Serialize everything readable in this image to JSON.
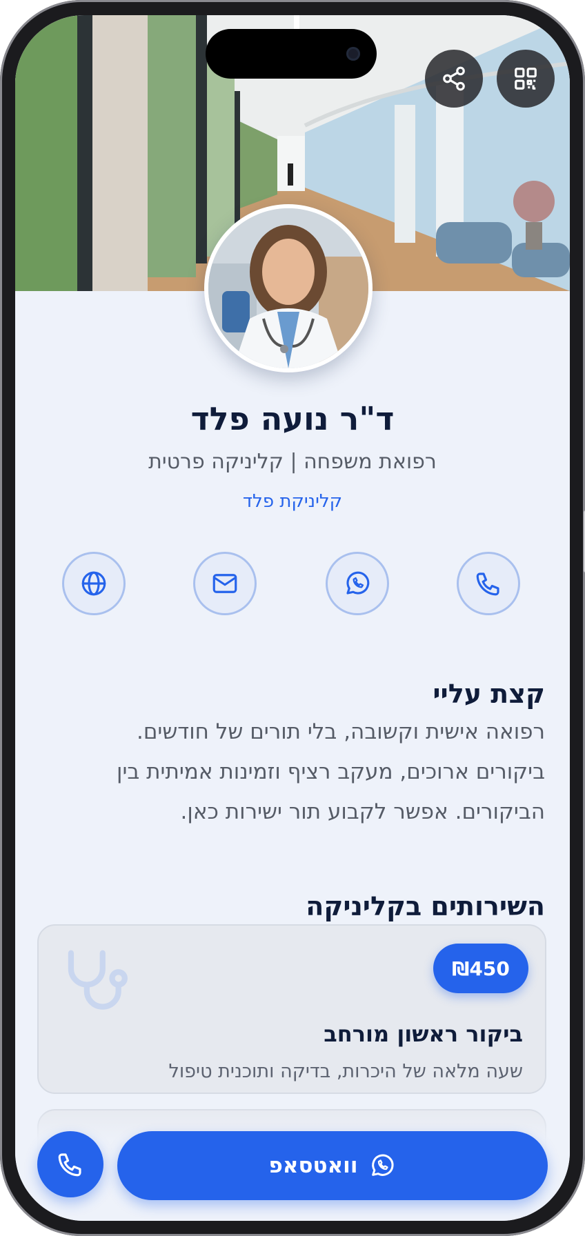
{
  "header": {
    "share_icon": "share-icon",
    "qr_icon": "qr-code-icon"
  },
  "profile": {
    "name": "ד\"ר נועה פלד",
    "subtitle": "רפואת משפחה | קליניקה פרטית",
    "clinic": "קליניקת פלד"
  },
  "contacts": [
    {
      "icon": "phone-icon"
    },
    {
      "icon": "whatsapp-icon"
    },
    {
      "icon": "mail-icon"
    },
    {
      "icon": "globe-icon"
    }
  ],
  "about": {
    "title": "קצת עליי",
    "text": "רפואה אישית וקשובה, בלי תורים של חודשים. ביקורים ארוכים, מעקב רציף וזמינות אמיתית בין הביקורים. אפשר לקבוע תור ישירות כאן."
  },
  "services": {
    "title": "השירותים בקליניקה",
    "items": [
      {
        "price": "₪450",
        "title": "ביקור ראשון מורחב",
        "description": "שעה מלאה של היכרות, בדיקה ותוכנית טיפול",
        "icon": "stethoscope-icon"
      }
    ]
  },
  "bottom_bar": {
    "whatsapp_label": "וואטסאפ",
    "call_icon": "phone-icon",
    "accent": "#2563eb"
  }
}
